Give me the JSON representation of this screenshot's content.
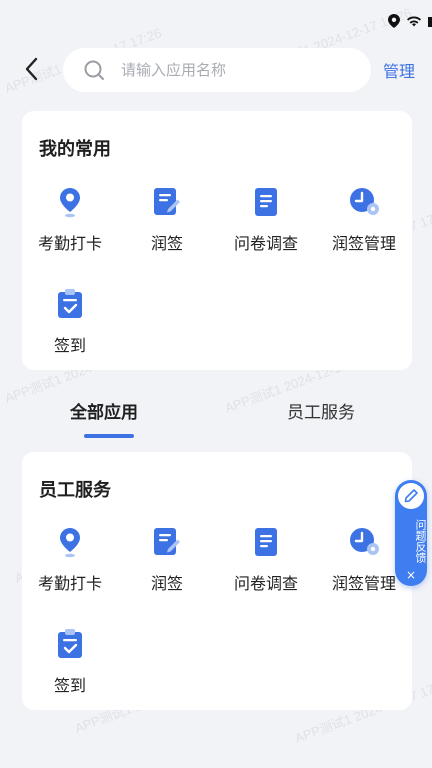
{
  "header": {
    "back_icon": "chevron-left-icon",
    "search_placeholder": "请输入应用名称",
    "manage_label": "管理"
  },
  "favorites": {
    "title": "我的常用",
    "apps": [
      {
        "label": "考勤打卡",
        "icon": "location-pin-icon"
      },
      {
        "label": "润签",
        "icon": "sign-edit-icon"
      },
      {
        "label": "问卷调查",
        "icon": "questionnaire-icon"
      },
      {
        "label": "润签管理",
        "icon": "sign-manage-icon"
      },
      {
        "label": "签到",
        "icon": "checkin-clipboard-icon"
      }
    ]
  },
  "tabs": [
    {
      "label": "全部应用",
      "active": true
    },
    {
      "label": "员工服务",
      "active": false
    }
  ],
  "staff_service": {
    "title": "员工服务",
    "apps": [
      {
        "label": "考勤打卡",
        "icon": "location-pin-icon"
      },
      {
        "label": "润签",
        "icon": "sign-edit-icon"
      },
      {
        "label": "问卷调查",
        "icon": "questionnaire-icon"
      },
      {
        "label": "润签管理",
        "icon": "sign-manage-icon"
      },
      {
        "label": "签到",
        "icon": "checkin-clipboard-icon"
      }
    ]
  },
  "feedback": {
    "label": "问题反馈",
    "close": "×"
  },
  "watermark": "APP测试1 2024-12-17 17:26",
  "colors": {
    "accent": "#3d72e4",
    "background": "#f2f3f7",
    "card": "#ffffff"
  }
}
